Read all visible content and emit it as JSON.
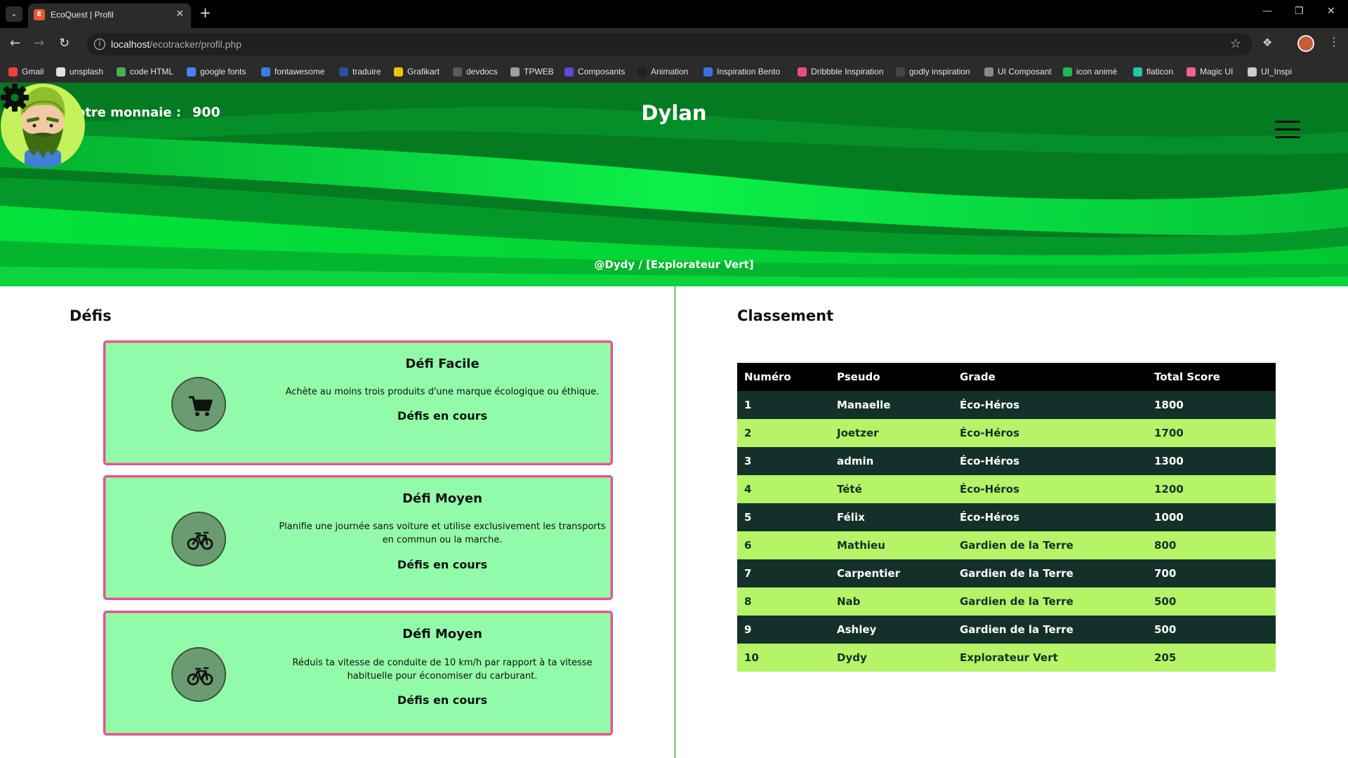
{
  "browser": {
    "tab_title": "EcoQuest | Profil",
    "url_host": "localhost",
    "url_path": "/ecotracker/profil.php",
    "bookmarks": [
      {
        "label": "Gmail",
        "color": "#ea4335"
      },
      {
        "label": "unsplash",
        "color": "#e0e0e0"
      },
      {
        "label": "code HTML",
        "color": "#4caf50"
      },
      {
        "label": "google fonts",
        "color": "#4285f4"
      },
      {
        "label": "fontawesome",
        "color": "#3d7be0"
      },
      {
        "label": "traduire",
        "color": "#2b4f9c"
      },
      {
        "label": "Grafikart",
        "color": "#f4c20d"
      },
      {
        "label": "devdocs",
        "color": "#5a5a5a"
      },
      {
        "label": "TPWEB",
        "color": "#9e9e9e"
      },
      {
        "label": "Composants",
        "color": "#5b4bd6"
      },
      {
        "label": "Animation",
        "color": "#222222"
      },
      {
        "label": "Inspiration Bento",
        "color": "#3b6fe0"
      },
      {
        "label": "Dribbble Inspiration",
        "color": "#ea4c89"
      },
      {
        "label": "godly inspiration",
        "color": "#444444"
      },
      {
        "label": "UI Composant",
        "color": "#888888"
      },
      {
        "label": "icon animé",
        "color": "#1db954"
      },
      {
        "label": "flaticon",
        "color": "#23c6a6"
      },
      {
        "label": "Magic UI",
        "color": "#f06292"
      },
      {
        "label": "UI_Inspi",
        "color": "#cccccc"
      }
    ]
  },
  "header": {
    "currency_label": "Votre monnaie :",
    "currency_value": "900",
    "username": "Dylan",
    "handle": "@Dydy / [Explorateur Vert]",
    "menu_icon": "hamburger-icon",
    "settings_icon": "gear-icon",
    "colors": {
      "hero_dark": "#047a21",
      "hero_light": "#06d83a"
    }
  },
  "challenges": {
    "title": "Défis",
    "items": [
      {
        "icon": "cart-icon",
        "title": "Défi Facile",
        "description": "Achète au moins trois produits d'une marque écologique ou éthique.",
        "status": "Défis en cours"
      },
      {
        "icon": "bicycle-icon",
        "title": "Défi Moyen",
        "description": "Planifie une journée sans voiture et utilise exclusivement les transports en commun ou la marche.",
        "status": "Défis en cours"
      },
      {
        "icon": "bicycle-icon",
        "title": "Défi Moyen",
        "description": "Réduis ta vitesse de conduite de 10 km/h par rapport à ta vitesse habituelle pour économiser du carburant.",
        "status": "Défis en cours"
      }
    ]
  },
  "ranking": {
    "title": "Classement",
    "columns": [
      "Numéro",
      "Pseudo",
      "Grade",
      "Total Score"
    ],
    "rows": [
      [
        "1",
        "Manaelle",
        "Éco-Héros",
        "1800"
      ],
      [
        "2",
        "Joetzer",
        "Éco-Héros",
        "1700"
      ],
      [
        "3",
        "admin",
        "Éco-Héros",
        "1300"
      ],
      [
        "4",
        "Tété",
        "Éco-Héros",
        "1200"
      ],
      [
        "5",
        "Félix",
        "Éco-Héros",
        "1000"
      ],
      [
        "6",
        "Mathieu",
        "Gardien de la Terre",
        "800"
      ],
      [
        "7",
        "Carpentier",
        "Gardien de la Terre",
        "700"
      ],
      [
        "8",
        "Nab",
        "Gardien de la Terre",
        "500"
      ],
      [
        "9",
        "Ashley",
        "Gardien de la Terre",
        "500"
      ],
      [
        "10",
        "Dydy",
        "Explorateur Vert",
        "205"
      ]
    ]
  }
}
